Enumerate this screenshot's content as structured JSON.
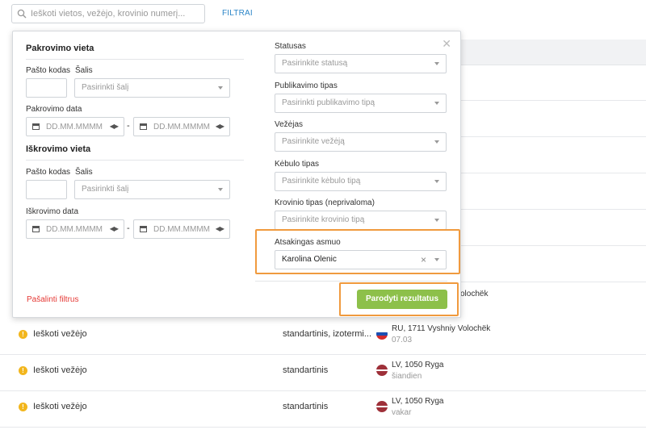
{
  "search": {
    "placeholder": "Ieškoti vietos, vežėjo, krovinio numerį..."
  },
  "filters_link": "FILTRAI",
  "panel": {
    "loading": {
      "title": "Pakrovimo vieta",
      "postcode_label": "Pašto kodas",
      "country_label": "Šalis",
      "country_placeholder": "Pasirinkti šalį",
      "date_label": "Pakrovimo data",
      "date_from": "DD.MM.MMMM",
      "date_to": "DD.MM.MMMM"
    },
    "unloading": {
      "title": "Iškrovimo vieta",
      "postcode_label": "Pašto kodas",
      "country_label": "Šalis",
      "country_placeholder": "Pasirinkti šalį",
      "date_label": "Iškrovimo data",
      "date_from": "DD.MM.MMMM",
      "date_to": "DD.MM.MMMM"
    },
    "status": {
      "label": "Statusas",
      "placeholder": "Pasirinkite statusą"
    },
    "publish_type": {
      "label": "Publikavimo tipas",
      "placeholder": "Pasirinkti publikavimo tipą"
    },
    "carrier": {
      "label": "Vežėjas",
      "placeholder": "Pasirinkite vežėją"
    },
    "body_type": {
      "label": "Kėbulo tipas",
      "placeholder": "Pasirinkite kėbulo tipą"
    },
    "cargo_type": {
      "label": "Krovinio tipas (neprivaloma)",
      "placeholder": "Pasirinkite krovinio tipą"
    },
    "responsible": {
      "label": "Atsakingas asmuo",
      "value": "Karolina Olenic"
    },
    "remove_filters": "Pašalinti filtrus",
    "show_results": "Parodyti rezultatus",
    "dash": "-"
  },
  "peek_text": "olochëk",
  "rows": [
    {
      "status": "Ieškoti vežėjo",
      "type": "standartinis, izotermi...",
      "flag": "ru",
      "location": "RU, 1711 Vyshniy Volochëk",
      "date": "07.03"
    },
    {
      "status": "Ieškoti vežėjo",
      "type": "standartinis",
      "flag": "lv",
      "location": "LV, 1050 Ryga",
      "date": "šiandien"
    },
    {
      "status": "Ieškoti vežėjo",
      "type": "standartinis",
      "flag": "lv",
      "location": "LV, 1050 Ryga",
      "date": "vakar"
    }
  ],
  "colors": {
    "accent": "#2c86c8",
    "warning": "#f2b61d",
    "primary_button": "#8dc04a",
    "highlight": "#f09a3e",
    "danger": "#e53935"
  }
}
